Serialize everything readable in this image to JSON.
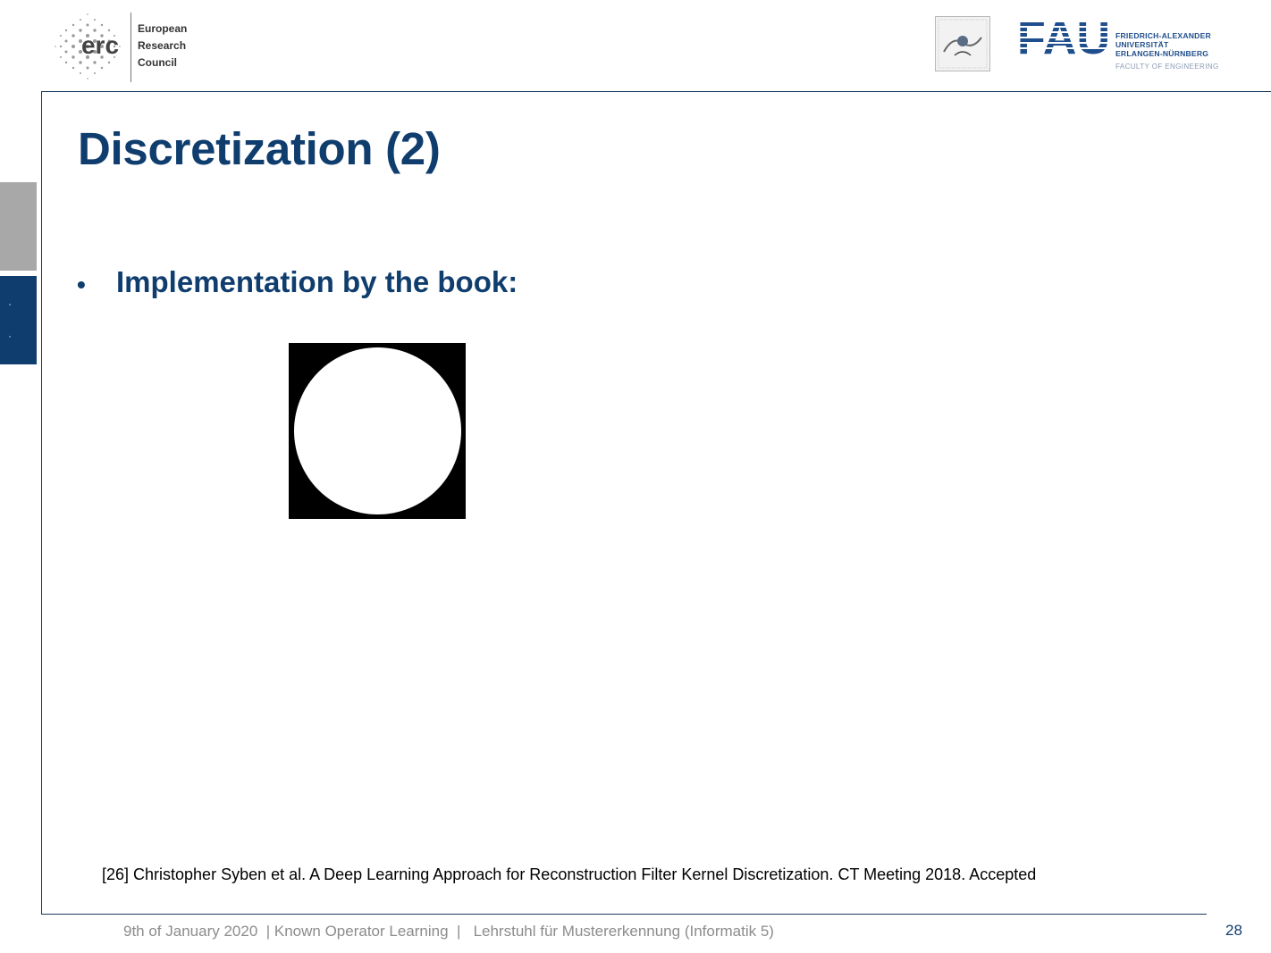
{
  "header": {
    "erc_logo_text": "erc",
    "erc_lines": [
      "European",
      "Research",
      "Council"
    ],
    "fau_logo_text": "FAU",
    "fau_lines": [
      "FRIEDRICH-ALEXANDER",
      "UNIVERSITÄT",
      "ERLANGEN-NÜRNBERG"
    ],
    "fau_faculty": "FACULTY OF ENGINEERING"
  },
  "slide": {
    "title": "Discretization (2)",
    "bullet_symbol": "•",
    "bullet": "Implementation by the book:",
    "reference": "[26] Christopher Syben et al. A Deep Learning Approach for Reconstruction Filter Kernel Discretization. CT Meeting 2018. Accepted"
  },
  "footer": {
    "text": "9th of January 2020  | Known Operator Learning  |   Lehrstuhl für Mustererkennung (Informatik 5)",
    "page_number": "28"
  },
  "colors": {
    "primary": "#0f3d6e",
    "footer_gray": "#8c8c8c"
  }
}
